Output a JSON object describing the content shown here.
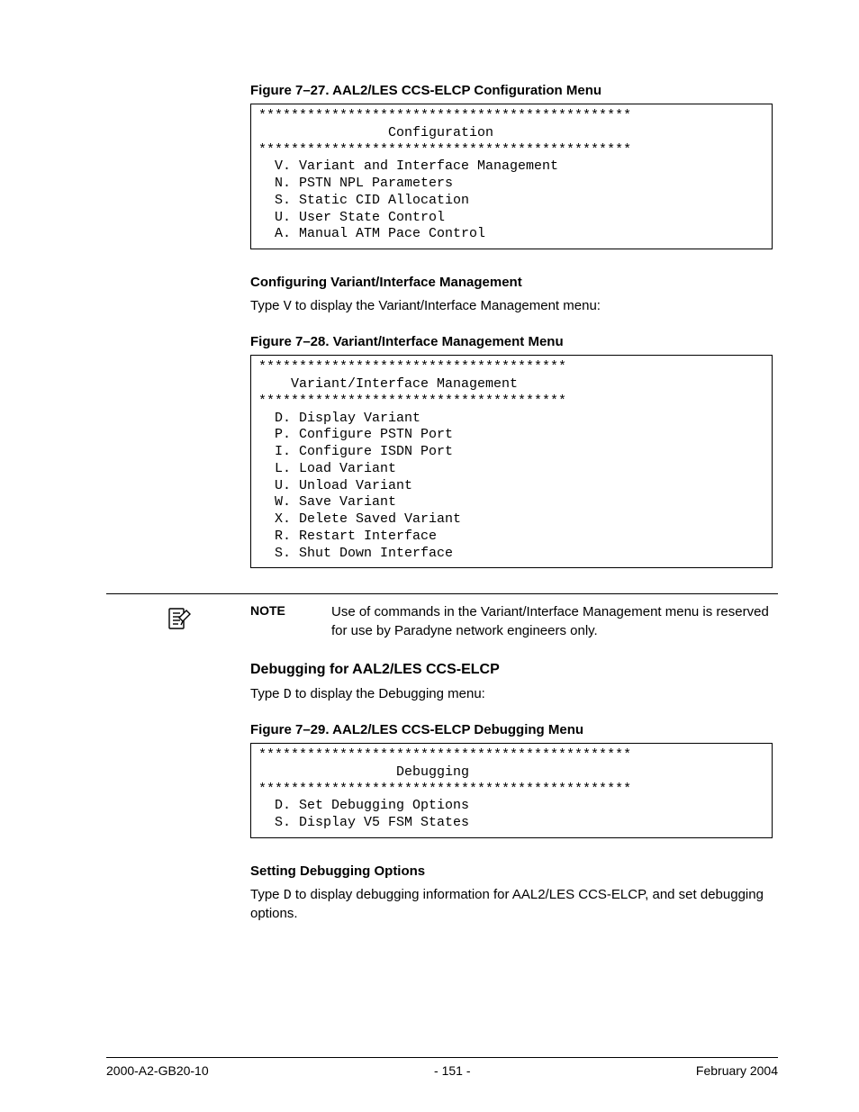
{
  "figure27": {
    "caption": "Figure 7–27.  AAL2/LES CCS-ELCP Configuration Menu",
    "text": "**********************************************\n                Configuration\n**********************************************\n  V. Variant and Interface Management\n  N. PSTN NPL Parameters\n  S. Static CID Allocation\n  U. User State Control\n  A. Manual ATM Pace Control"
  },
  "section_variant": {
    "heading": "Configuring Variant/Interface Management",
    "body_prefix": "Type ",
    "body_code": "V",
    "body_suffix": " to display the Variant/Interface Management menu:"
  },
  "figure28": {
    "caption": "Figure 7–28.  Variant/Interface Management Menu",
    "text": "**************************************\n    Variant/Interface Management\n**************************************\n  D. Display Variant\n  P. Configure PSTN Port\n  I. Configure ISDN Port\n  L. Load Variant\n  U. Unload Variant\n  W. Save Variant\n  X. Delete Saved Variant\n  R. Restart Interface\n  S. Shut Down Interface"
  },
  "note": {
    "label": "NOTE",
    "body": "Use of commands in the Variant/Interface Management menu is reserved for use by Paradyne network engineers only."
  },
  "section_debug": {
    "heading": "Debugging for AAL2/LES CCS-ELCP",
    "body_prefix": "Type ",
    "body_code": "D",
    "body_suffix": " to display the Debugging menu:"
  },
  "figure29": {
    "caption": "Figure 7–29.  AAL2/LES CCS-ELCP Debugging Menu",
    "text": "**********************************************\n                 Debugging\n**********************************************\n  D. Set Debugging Options\n  S. Display V5 FSM States"
  },
  "section_setdebug": {
    "heading": "Setting Debugging Options",
    "body_prefix": "Type ",
    "body_code": "D",
    "body_suffix": " to display debugging information for AAL2/LES CCS-ELCP, and set debugging options."
  },
  "footer": {
    "left": "2000-A2-GB20-10",
    "center": "- 151 -",
    "right": "February 2004"
  }
}
